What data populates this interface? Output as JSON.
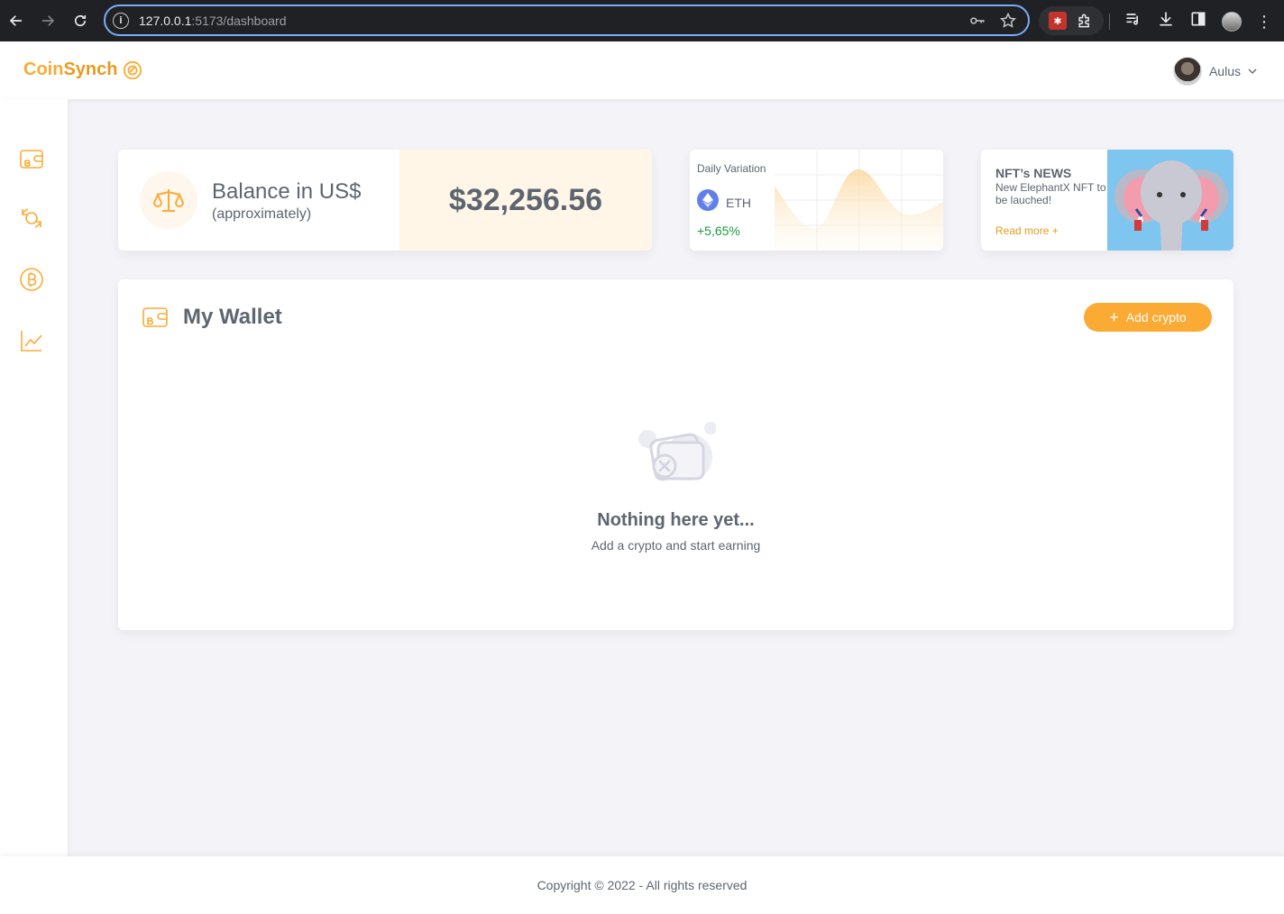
{
  "browser": {
    "url_host": "127.0.0.1",
    "url_path": ":5173/dashboard"
  },
  "header": {
    "logo_coin": "Coin",
    "logo_synch": "Synch",
    "user_name": "Aulus"
  },
  "sidebar": {
    "items": [
      {
        "icon": "wallet-icon"
      },
      {
        "icon": "exchange-icon"
      },
      {
        "icon": "bitcoin-icon"
      },
      {
        "icon": "chart-line-icon"
      }
    ]
  },
  "balance": {
    "title": "Balance in US$",
    "subtitle": "(approximately)",
    "value": "$32,256.56"
  },
  "daily_variation": {
    "title": "Daily Variation",
    "coin": "ETH",
    "change": "+5,65%",
    "change_color": "#1a9c3e"
  },
  "nft_news": {
    "title": "NFT’s NEWS",
    "text": "New ElephantX NFT to be lauched!",
    "link": "Read more +"
  },
  "wallet": {
    "title": "My Wallet",
    "add_button": "Add crypto",
    "empty_title": "Nothing here yet...",
    "empty_subtitle": "Add a crypto and start earning"
  },
  "footer": {
    "copyright": "Copyright © 2022 - All rights reserved"
  },
  "colors": {
    "accent": "#fbab34",
    "text": "#5d6670",
    "background": "#f4f4f8"
  }
}
